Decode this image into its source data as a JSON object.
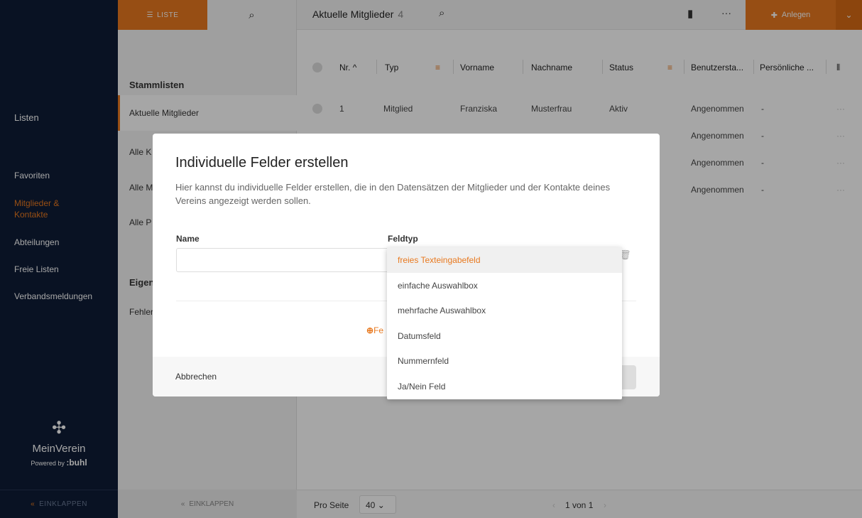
{
  "sidebar": {
    "title": "Listen",
    "nav": [
      "Favoriten",
      "Mitglieder & Kontakte",
      "Abteilungen",
      "Freie Listen",
      "Verbandsmeldungen"
    ],
    "logo_name": "MeinVerein",
    "powered_by": "Powered by",
    "brand": ":buhl",
    "collapse": "EINKLAPPEN"
  },
  "lists": {
    "liste_btn": "LISTE",
    "heading1": "Stammlisten",
    "items": [
      "Aktuelle Mitglieder",
      "Alle K",
      "Alle M",
      "Alle P"
    ],
    "heading2": "Eigen",
    "item_err": "Fehler",
    "collapse": "EINKLAPPEN"
  },
  "main": {
    "title": "Aktuelle Mitglieder",
    "count": "4",
    "anlegen": "Anlegen",
    "columns": [
      "Nr.",
      "Typ",
      "Vorname",
      "Nachname",
      "Status",
      "Benutzersta...",
      "Persönliche ..."
    ],
    "rows": [
      {
        "nr": "1",
        "typ": "Mitglied",
        "vorname": "Franziska",
        "nachname": "Musterfrau",
        "status": "Aktiv",
        "benutzer": "Angenommen",
        "pers": "-"
      },
      {
        "nr": "",
        "typ": "",
        "vorname": "",
        "nachname": "",
        "status": "",
        "benutzer": "Angenommen",
        "pers": "-"
      },
      {
        "nr": "",
        "typ": "",
        "vorname": "",
        "nachname": "",
        "status": "",
        "benutzer": "Angenommen",
        "pers": "-"
      },
      {
        "nr": "",
        "typ": "",
        "vorname": "",
        "nachname": "",
        "status": "",
        "benutzer": "Angenommen",
        "pers": "-"
      }
    ],
    "row_more": "···",
    "pager": {
      "pro_seite": "Pro Seite",
      "per_page": "40",
      "page_info": "1 von 1"
    }
  },
  "modal": {
    "title": "Individuelle Felder erstellen",
    "description": "Hier kannst du individuelle Felder erstellen, die in den Datensätzen der Mitglieder und der Kontakte deines Vereins angezeigt werden sollen.",
    "name_label": "Name",
    "name_value": "",
    "type_label": "Feldtyp",
    "add_field": "Fe",
    "cancel": "Abbrechen"
  },
  "dropdown": {
    "options": [
      "freies Texteingabefeld",
      "einfache Auswahlbox",
      "mehrfache Auswahlbox",
      "Datumsfeld",
      "Nummernfeld",
      "Ja/Nein Feld"
    ],
    "selected": "freies Texteingabefeld"
  },
  "colors": {
    "accent": "#e8791f",
    "sidebar_bg": "#0e1c36"
  }
}
